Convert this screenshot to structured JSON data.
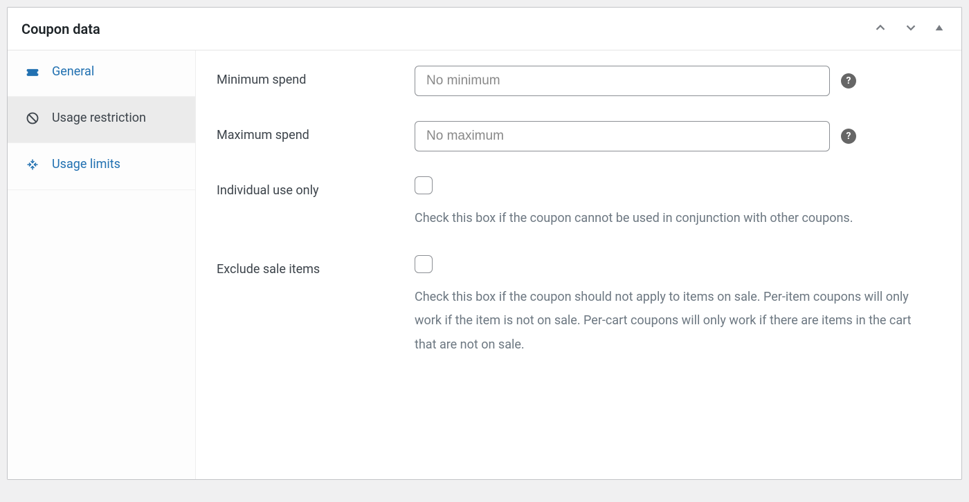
{
  "panel": {
    "title": "Coupon data"
  },
  "sidebar": {
    "items": [
      {
        "label": "General",
        "active": false
      },
      {
        "label": "Usage restriction",
        "active": true
      },
      {
        "label": "Usage limits",
        "active": false
      }
    ]
  },
  "form": {
    "minimum_spend": {
      "label": "Minimum spend",
      "placeholder": "No minimum",
      "value": ""
    },
    "maximum_spend": {
      "label": "Maximum spend",
      "placeholder": "No maximum",
      "value": ""
    },
    "individual_use": {
      "label": "Individual use only",
      "description": "Check this box if the coupon cannot be used in conjunction with other coupons."
    },
    "exclude_sale": {
      "label": "Exclude sale items",
      "description": "Check this box if the coupon should not apply to items on sale. Per-item coupons will only work if the item is not on sale. Per-cart coupons will only work if there are items in the cart that are not on sale."
    }
  }
}
